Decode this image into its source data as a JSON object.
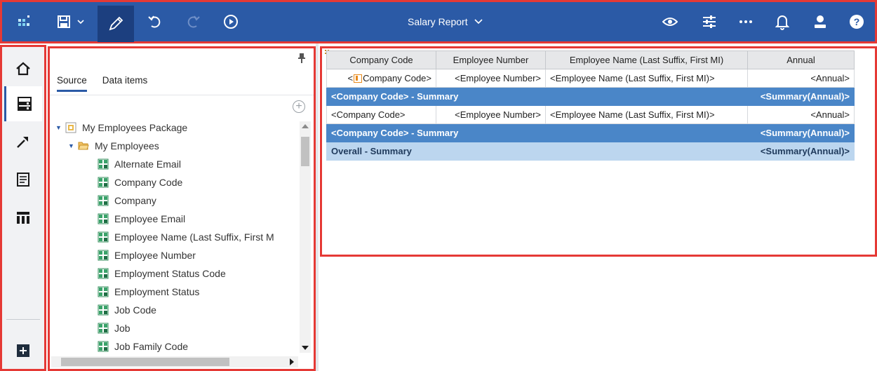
{
  "topbar": {
    "report_title": "Salary Report",
    "icons": [
      "apps-icon",
      "save-icon",
      "chevron-down-icon",
      "pencil-icon",
      "undo-icon",
      "redo-icon",
      "play-icon",
      "eye-icon",
      "sliders-icon",
      "more-icon",
      "bell-icon",
      "user-icon",
      "help-icon"
    ]
  },
  "rail": {
    "items": [
      "home-icon",
      "data-source-icon",
      "hammer-icon",
      "pages-icon",
      "table-icon"
    ],
    "bottom": "add-icon"
  },
  "panel": {
    "tabs": [
      "Source",
      "Data items"
    ],
    "active_tab": "Source",
    "tree": {
      "package": "My Employees Package",
      "folder": "My Employees",
      "items": [
        "Alternate Email",
        "Company Code",
        "Company",
        "Employee Email",
        "Employee Name (Last Suffix, First M",
        "Employee Number",
        "Employment Status Code",
        "Employment Status",
        "Job Code",
        "Job",
        "Job Family Code"
      ]
    }
  },
  "report": {
    "headers": [
      "Company Code",
      "Employee Number",
      "Employee Name (Last Suffix, First MI)",
      "Annual"
    ],
    "row1": {
      "company_code_prefix": "<",
      "company_code_suffix": "Company Code>",
      "employee_number": "<Employee Number>",
      "employee_name": "<Employee Name (Last Suffix, First MI)>",
      "annual": "<Annual>"
    },
    "summary1": {
      "label": "<Company Code>  -  Summary",
      "value": "<Summary(Annual)>"
    },
    "row2": {
      "company_code": "<Company Code>",
      "employee_number": "<Employee Number>",
      "employee_name": "<Employee Name (Last Suffix, First MI)>",
      "annual": "<Annual>"
    },
    "summary2": {
      "label": "<Company Code>  -  Summary",
      "value": "<Summary(Annual)>"
    },
    "overall": {
      "label": "Overall  -  Summary",
      "value": "<Summary(Annual)>"
    }
  },
  "colors": {
    "topbar": "#2b5aa6",
    "highlight_border": "#e53935",
    "summary_blue": "#4a86c8",
    "summary_light": "#bcd6ef",
    "header_gray": "#e6e7e9"
  }
}
